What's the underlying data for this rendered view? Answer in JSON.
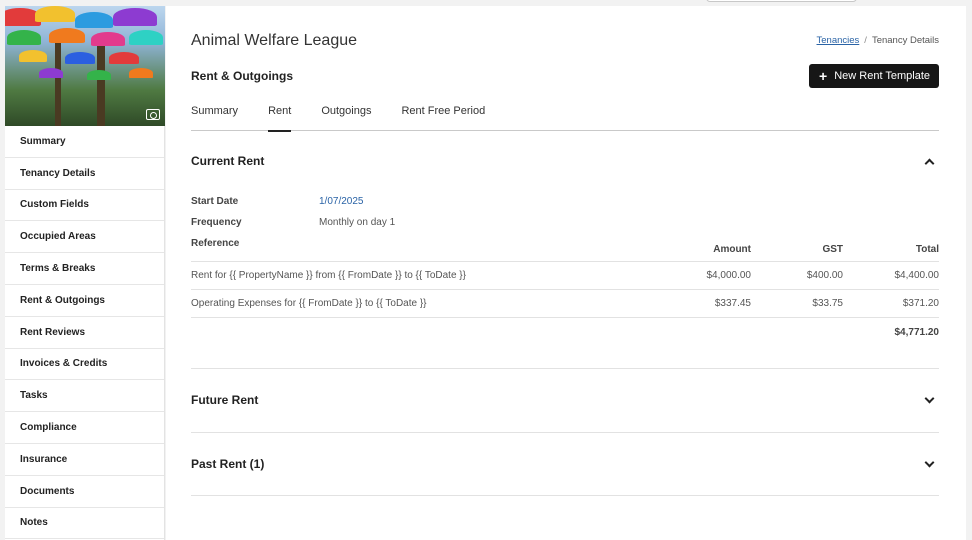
{
  "sidebar": {
    "items": [
      {
        "label": "Summary"
      },
      {
        "label": "Tenancy Details"
      },
      {
        "label": "Custom Fields"
      },
      {
        "label": "Occupied Areas"
      },
      {
        "label": "Terms & Breaks"
      },
      {
        "label": "Rent & Outgoings"
      },
      {
        "label": "Rent Reviews"
      },
      {
        "label": "Invoices & Credits"
      },
      {
        "label": "Tasks"
      },
      {
        "label": "Compliance"
      },
      {
        "label": "Insurance"
      },
      {
        "label": "Documents"
      },
      {
        "label": "Notes"
      }
    ]
  },
  "header": {
    "title": "Animal Welfare League",
    "subtitle": "Rent & Outgoings",
    "breadcrumb": {
      "link": "Tenancies",
      "separator": "/",
      "current": "Tenancy Details"
    },
    "new_button_label": "New Rent Template",
    "new_button_icon": "plus-icon"
  },
  "tabs": [
    {
      "label": "Summary",
      "active": false
    },
    {
      "label": "Rent",
      "active": true
    },
    {
      "label": "Outgoings",
      "active": false
    },
    {
      "label": "Rent Free Period",
      "active": false
    }
  ],
  "current_rent": {
    "title": "Current Rent",
    "expanded": true,
    "start_date_label": "Start Date",
    "start_date": "1/07/2025",
    "frequency_label": "Frequency",
    "frequency": "Monthly on day 1",
    "reference_label": "Reference",
    "columns": {
      "amount": "Amount",
      "gst": "GST",
      "total": "Total"
    },
    "rows": [
      {
        "reference": "Rent for {{ PropertyName }} from {{ FromDate }} to {{ ToDate }}",
        "amount": "$4,000.00",
        "gst": "$400.00",
        "total": "$4,400.00"
      },
      {
        "reference": "Operating Expenses for {{ FromDate }} to {{ ToDate }}",
        "amount": "$337.45",
        "gst": "$33.75",
        "total": "$371.20"
      }
    ],
    "grand_total": "$4,771.20"
  },
  "future_rent": {
    "title": "Future Rent",
    "expanded": false
  },
  "past_rent": {
    "title": "Past Rent (1)",
    "expanded": false
  },
  "colors": {
    "accent_link": "#2a63a6",
    "button_bg": "#161616",
    "active_tab_underline": "#222222"
  }
}
